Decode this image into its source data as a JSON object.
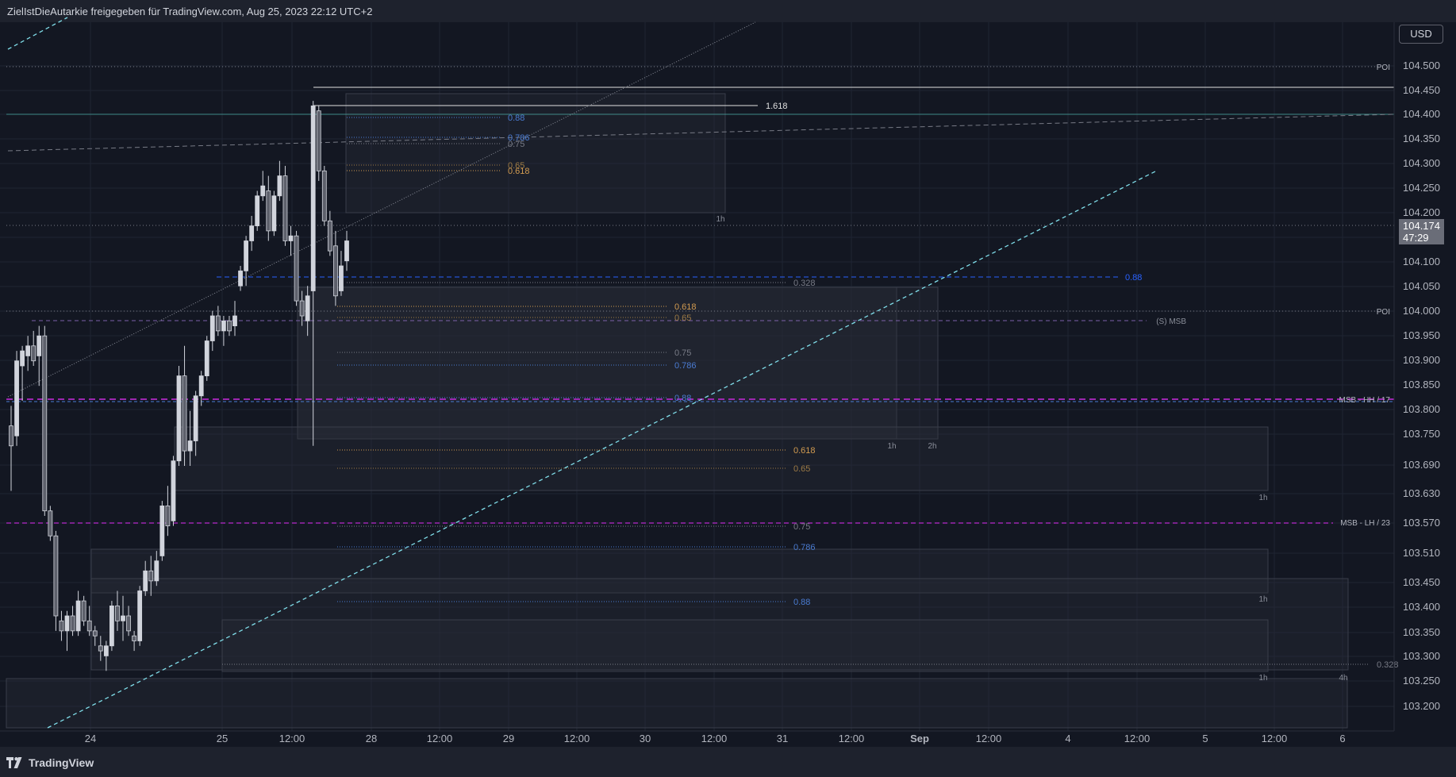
{
  "header": {
    "text": "ZielIstDieAutarkie freigegeben für TradingView.com, Aug 25, 2023 22:12 UTC+2"
  },
  "footer": {
    "brand": "TradingView"
  },
  "toolbar": {
    "currency": "USD"
  },
  "last_price": {
    "value": "104.174",
    "countdown": "47:29"
  },
  "colors": {
    "background": "#131722",
    "candle": "#d1d4dc",
    "fib_blue": "#4a7bd1",
    "fib_orange": "#d29b50",
    "fib_grey": "#787b86",
    "trendline": "#80deea",
    "msb_purple": "#9c27b0",
    "current_level_blue": "#2962ff"
  },
  "chart_data": {
    "type": "candlestick",
    "y_axis": {
      "ticks": [
        "104.500",
        "104.450",
        "104.400",
        "104.350",
        "104.300",
        "104.250",
        "104.200",
        "104.150",
        "104.100",
        "104.050",
        "104.000",
        "103.950",
        "103.900",
        "103.850",
        "103.800",
        "103.750",
        "103.690",
        "103.630",
        "103.570",
        "103.510",
        "103.450",
        "103.400",
        "103.350",
        "103.300",
        "103.250",
        "103.200"
      ],
      "range": [
        103.185,
        104.545
      ]
    },
    "x_axis": {
      "ticks": [
        "24",
        "25",
        "12:00",
        "28",
        "12:00",
        "29",
        "12:00",
        "30",
        "12:00",
        "31",
        "12:00",
        "Sep",
        "12:00",
        "4",
        "12:00",
        "5",
        "12:00",
        "6"
      ]
    },
    "candles": [
      {
        "o": 103.78,
        "h": 103.82,
        "l": 103.65,
        "c": 103.74
      },
      {
        "o": 103.76,
        "h": 103.93,
        "l": 103.74,
        "c": 103.91
      },
      {
        "o": 103.9,
        "h": 103.94,
        "l": 103.83,
        "c": 103.93
      },
      {
        "o": 103.92,
        "h": 103.96,
        "l": 103.89,
        "c": 103.94
      },
      {
        "o": 103.94,
        "h": 103.97,
        "l": 103.9,
        "c": 103.91
      },
      {
        "o": 103.92,
        "h": 103.98,
        "l": 103.86,
        "c": 103.96
      },
      {
        "o": 103.96,
        "h": 103.98,
        "l": 103.6,
        "c": 103.61
      },
      {
        "o": 103.61,
        "h": 103.62,
        "l": 103.55,
        "c": 103.56
      },
      {
        "o": 103.56,
        "h": 103.57,
        "l": 103.37,
        "c": 103.4
      },
      {
        "o": 103.39,
        "h": 103.41,
        "l": 103.35,
        "c": 103.37
      },
      {
        "o": 103.37,
        "h": 103.41,
        "l": 103.33,
        "c": 103.4
      },
      {
        "o": 103.4,
        "h": 103.42,
        "l": 103.36,
        "c": 103.37
      },
      {
        "o": 103.37,
        "h": 103.45,
        "l": 103.36,
        "c": 103.43
      },
      {
        "o": 103.43,
        "h": 103.44,
        "l": 103.38,
        "c": 103.39
      },
      {
        "o": 103.39,
        "h": 103.42,
        "l": 103.36,
        "c": 103.37
      },
      {
        "o": 103.37,
        "h": 103.38,
        "l": 103.34,
        "c": 103.36
      },
      {
        "o": 103.34,
        "h": 103.36,
        "l": 103.31,
        "c": 103.33
      },
      {
        "o": 103.32,
        "h": 103.35,
        "l": 103.29,
        "c": 103.34
      },
      {
        "o": 103.34,
        "h": 103.43,
        "l": 103.33,
        "c": 103.42
      },
      {
        "o": 103.42,
        "h": 103.45,
        "l": 103.37,
        "c": 103.39
      },
      {
        "o": 103.39,
        "h": 103.44,
        "l": 103.35,
        "c": 103.4
      },
      {
        "o": 103.4,
        "h": 103.42,
        "l": 103.36,
        "c": 103.37
      },
      {
        "o": 103.36,
        "h": 103.37,
        "l": 103.33,
        "c": 103.35
      },
      {
        "o": 103.35,
        "h": 103.46,
        "l": 103.34,
        "c": 103.45
      },
      {
        "o": 103.45,
        "h": 103.51,
        "l": 103.44,
        "c": 103.49
      },
      {
        "o": 103.49,
        "h": 103.52,
        "l": 103.44,
        "c": 103.47
      },
      {
        "o": 103.47,
        "h": 103.53,
        "l": 103.46,
        "c": 103.51
      },
      {
        "o": 103.52,
        "h": 103.63,
        "l": 103.51,
        "c": 103.62
      },
      {
        "o": 103.62,
        "h": 103.66,
        "l": 103.56,
        "c": 103.58
      },
      {
        "o": 103.59,
        "h": 103.72,
        "l": 103.58,
        "c": 103.71
      },
      {
        "o": 103.71,
        "h": 103.9,
        "l": 103.7,
        "c": 103.88
      },
      {
        "o": 103.88,
        "h": 103.94,
        "l": 103.7,
        "c": 103.73
      },
      {
        "o": 103.73,
        "h": 103.81,
        "l": 103.7,
        "c": 103.75
      },
      {
        "o": 103.75,
        "h": 103.85,
        "l": 103.72,
        "c": 103.84
      },
      {
        "o": 103.84,
        "h": 103.89,
        "l": 103.82,
        "c": 103.88
      },
      {
        "o": 103.88,
        "h": 103.96,
        "l": 103.87,
        "c": 103.95
      },
      {
        "o": 103.95,
        "h": 104.01,
        "l": 103.93,
        "c": 104.0
      },
      {
        "o": 104.0,
        "h": 104.02,
        "l": 103.96,
        "c": 103.97
      },
      {
        "o": 103.97,
        "h": 104.0,
        "l": 103.94,
        "c": 103.99
      },
      {
        "o": 103.99,
        "h": 104.0,
        "l": 103.96,
        "c": 103.97
      },
      {
        "o": 103.98,
        "h": 104.03,
        "l": 103.96,
        "c": 104.0
      },
      {
        "o": 104.06,
        "h": 104.1,
        "l": 104.05,
        "c": 104.09
      },
      {
        "o": 104.09,
        "h": 104.16,
        "l": 104.06,
        "c": 104.15
      },
      {
        "o": 104.15,
        "h": 104.2,
        "l": 104.13,
        "c": 104.18
      },
      {
        "o": 104.18,
        "h": 104.25,
        "l": 104.17,
        "c": 104.24
      },
      {
        "o": 104.24,
        "h": 104.29,
        "l": 104.23,
        "c": 104.26
      },
      {
        "o": 104.25,
        "h": 104.28,
        "l": 104.15,
        "c": 104.17
      },
      {
        "o": 104.17,
        "h": 104.25,
        "l": 104.16,
        "c": 104.24
      },
      {
        "o": 104.24,
        "h": 104.31,
        "l": 104.23,
        "c": 104.28
      },
      {
        "o": 104.28,
        "h": 104.3,
        "l": 104.14,
        "c": 104.15
      },
      {
        "o": 104.15,
        "h": 104.18,
        "l": 104.12,
        "c": 104.16
      },
      {
        "o": 104.16,
        "h": 104.17,
        "l": 104.02,
        "c": 104.03
      },
      {
        "o": 104.03,
        "h": 104.05,
        "l": 103.98,
        "c": 104.0
      },
      {
        "o": 103.99,
        "h": 104.06,
        "l": 103.96,
        "c": 104.04
      },
      {
        "o": 104.05,
        "h": 104.43,
        "l": 103.74,
        "c": 104.42
      },
      {
        "o": 104.41,
        "h": 104.42,
        "l": 104.27,
        "c": 104.29
      },
      {
        "o": 104.29,
        "h": 104.3,
        "l": 104.18,
        "c": 104.19
      },
      {
        "o": 104.19,
        "h": 104.21,
        "l": 104.12,
        "c": 104.13
      },
      {
        "o": 104.14,
        "h": 104.17,
        "l": 104.02,
        "c": 104.04
      },
      {
        "o": 104.05,
        "h": 104.13,
        "l": 104.04,
        "c": 104.1
      },
      {
        "o": 104.11,
        "h": 104.17,
        "l": 104.09,
        "c": 104.15
      }
    ],
    "horizontal_levels": [
      {
        "label": "POI",
        "value": 104.5
      },
      {
        "label": "POI",
        "value": 104.0
      },
      {
        "label": "(S) MSB",
        "value": 103.975
      },
      {
        "label": "MSB - HH / 17",
        "value": 103.818
      },
      {
        "label": "MSB - LH / 23",
        "value": 103.572
      }
    ],
    "fib_labels": [
      "1.618",
      "0.88",
      "0.786",
      "0.75",
      "0.65",
      "0.618",
      "0.328",
      "0.618",
      "0.65",
      "0.75",
      "0.786",
      "0.88",
      "0.618",
      "0.65",
      "0.75",
      "0.786",
      "0.88",
      "0.328"
    ],
    "zone_timeframes": [
      "1h",
      "1h",
      "2h",
      "1h",
      "1h",
      "1h",
      "4h"
    ]
  }
}
